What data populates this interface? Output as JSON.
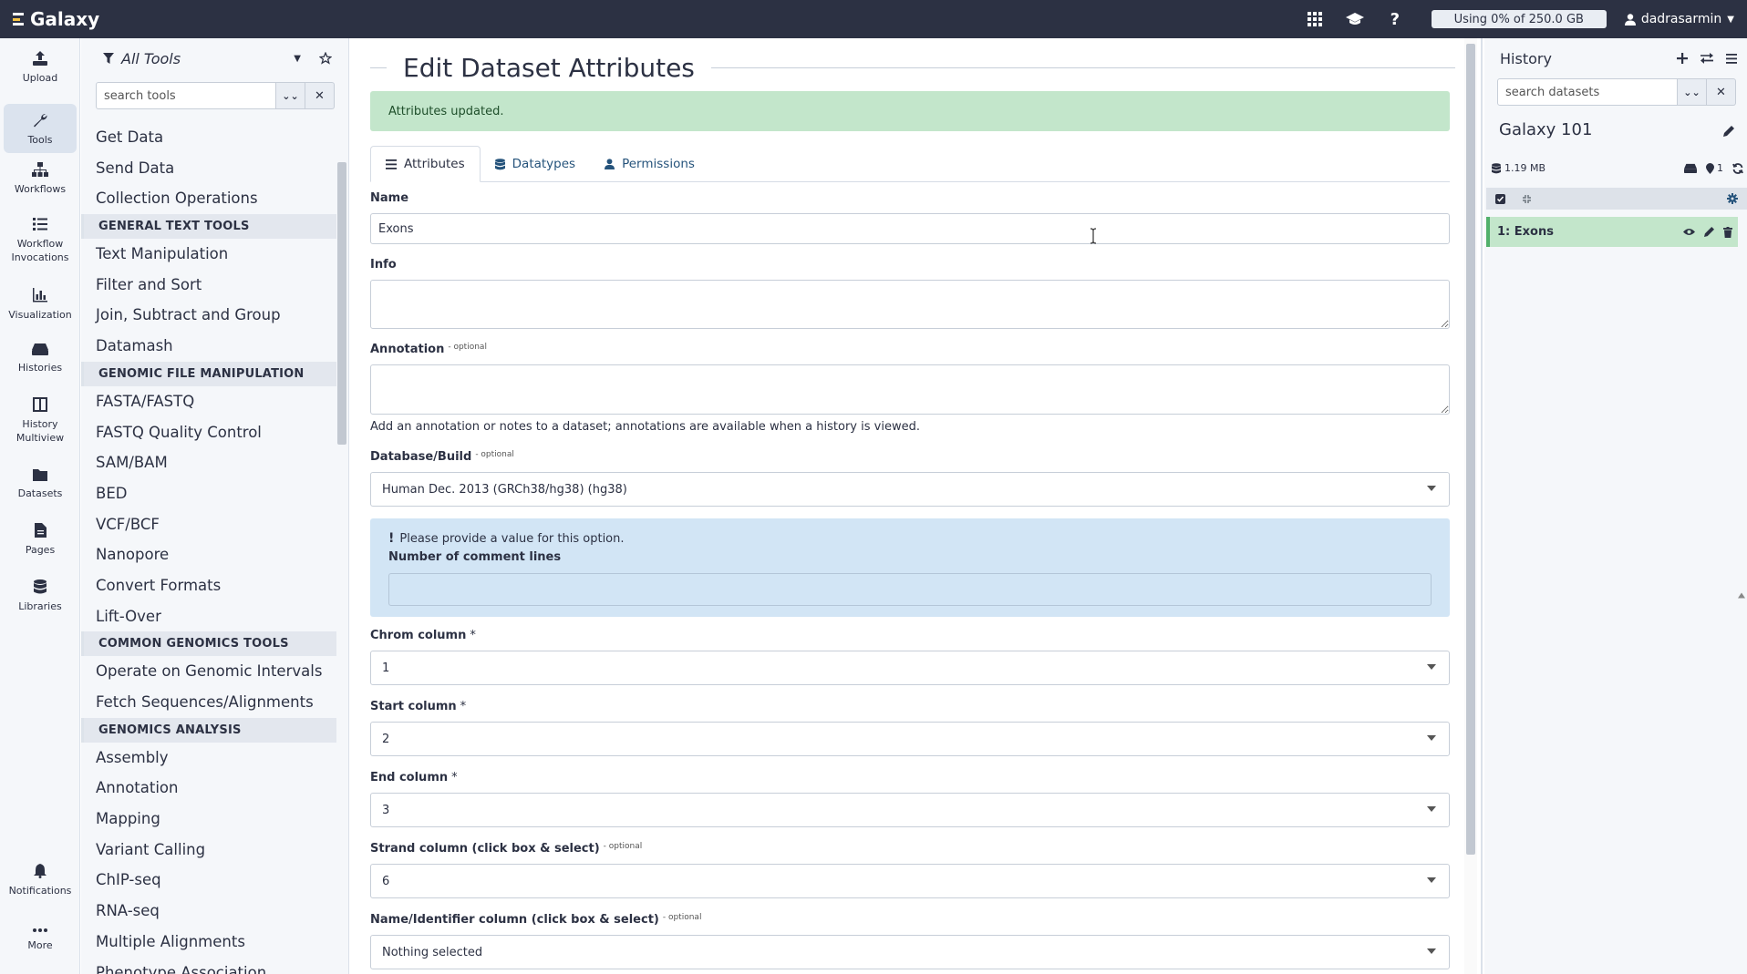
{
  "masthead": {
    "brand": "Galaxy",
    "quota": "Using 0% of 250.0 GB",
    "username": "dadrasarmin"
  },
  "activity_bar": {
    "items": [
      {
        "label": "Upload",
        "icon": "upload-icon"
      },
      {
        "label": "Tools",
        "icon": "wrench-icon"
      },
      {
        "label": "Workflows",
        "icon": "sitemap-icon"
      },
      {
        "label": "Workflow Invocations",
        "icon": "list-icon"
      },
      {
        "label": "Visualization",
        "icon": "chart-bar-icon"
      },
      {
        "label": "Histories",
        "icon": "hdd-icon"
      },
      {
        "label": "History Multiview",
        "icon": "columns-icon"
      },
      {
        "label": "Datasets",
        "icon": "folder-icon"
      },
      {
        "label": "Pages",
        "icon": "file-icon"
      },
      {
        "label": "Libraries",
        "icon": "database-icon"
      }
    ],
    "bottom": [
      {
        "label": "Notifications",
        "icon": "bell-icon"
      },
      {
        "label": "More",
        "icon": "ellipsis-icon"
      }
    ]
  },
  "tool_panel": {
    "title": "All Tools",
    "search_placeholder": "search tools",
    "entries": [
      {
        "type": "item",
        "label": "Get Data"
      },
      {
        "type": "item",
        "label": "Send Data"
      },
      {
        "type": "item",
        "label": "Collection Operations"
      },
      {
        "type": "section",
        "label": "GENERAL TEXT TOOLS"
      },
      {
        "type": "item",
        "label": "Text Manipulation"
      },
      {
        "type": "item",
        "label": "Filter and Sort"
      },
      {
        "type": "item",
        "label": "Join, Subtract and Group"
      },
      {
        "type": "item",
        "label": "Datamash"
      },
      {
        "type": "section",
        "label": "GENOMIC FILE MANIPULATION"
      },
      {
        "type": "item",
        "label": "FASTA/FASTQ"
      },
      {
        "type": "item",
        "label": "FASTQ Quality Control"
      },
      {
        "type": "item",
        "label": "SAM/BAM"
      },
      {
        "type": "item",
        "label": "BED"
      },
      {
        "type": "item",
        "label": "VCF/BCF"
      },
      {
        "type": "item",
        "label": "Nanopore"
      },
      {
        "type": "item",
        "label": "Convert Formats"
      },
      {
        "type": "item",
        "label": "Lift-Over"
      },
      {
        "type": "section",
        "label": "COMMON GENOMICS TOOLS"
      },
      {
        "type": "item",
        "label": "Operate on Genomic Intervals"
      },
      {
        "type": "item",
        "label": "Fetch Sequences/Alignments"
      },
      {
        "type": "section",
        "label": "GENOMICS ANALYSIS"
      },
      {
        "type": "item",
        "label": "Assembly"
      },
      {
        "type": "item",
        "label": "Annotation"
      },
      {
        "type": "item",
        "label": "Mapping"
      },
      {
        "type": "item",
        "label": "Variant Calling"
      },
      {
        "type": "item",
        "label": "ChIP-seq"
      },
      {
        "type": "item",
        "label": "RNA-seq"
      },
      {
        "type": "item",
        "label": "Multiple Alignments"
      },
      {
        "type": "item",
        "label": "Phenotype Association"
      }
    ]
  },
  "main": {
    "title": "Edit Dataset Attributes",
    "alert": "Attributes updated.",
    "tabs": [
      {
        "label": "Attributes",
        "icon": "bars-icon"
      },
      {
        "label": "Datatypes",
        "icon": "database-icon"
      },
      {
        "label": "Permissions",
        "icon": "user-icon"
      }
    ],
    "form": {
      "name_label": "Name",
      "name_value": "Exons",
      "info_label": "Info",
      "info_value": "",
      "annotation_label": "Annotation",
      "optional_tag": "- optional",
      "annotation_value": "",
      "annotation_help": "Add an annotation or notes to a dataset; annotations are available when a history is viewed.",
      "dbkey_label": "Database/Build",
      "dbkey_value": "Human Dec. 2013 (GRCh38/hg38) (hg38)",
      "warning_message": "Please provide a value for this option.",
      "comment_lines_label": "Number of comment lines",
      "comment_lines_value": "",
      "required_mark": "*",
      "chrom_label": "Chrom column",
      "chrom_value": "1",
      "start_label": "Start column",
      "start_value": "2",
      "end_label": "End column",
      "end_value": "3",
      "strand_label": "Strand column (click box & select)",
      "strand_value": "6",
      "nameid_label": "Name/Identifier column (click box & select)",
      "nameid_value": "Nothing selected"
    }
  },
  "history": {
    "title": "History",
    "search_placeholder": "search datasets",
    "name": "Galaxy 101",
    "size": "1.19 MB",
    "deleted_hidden_count": "1",
    "datasets": [
      {
        "hid_name": "1: Exons",
        "state": "ok",
        "color": "#c3e6cb"
      }
    ]
  },
  "colors": {
    "masthead": "#2c3143",
    "success": "#c3e6cb",
    "info": "#d2e5f5",
    "link": "#25537b"
  }
}
